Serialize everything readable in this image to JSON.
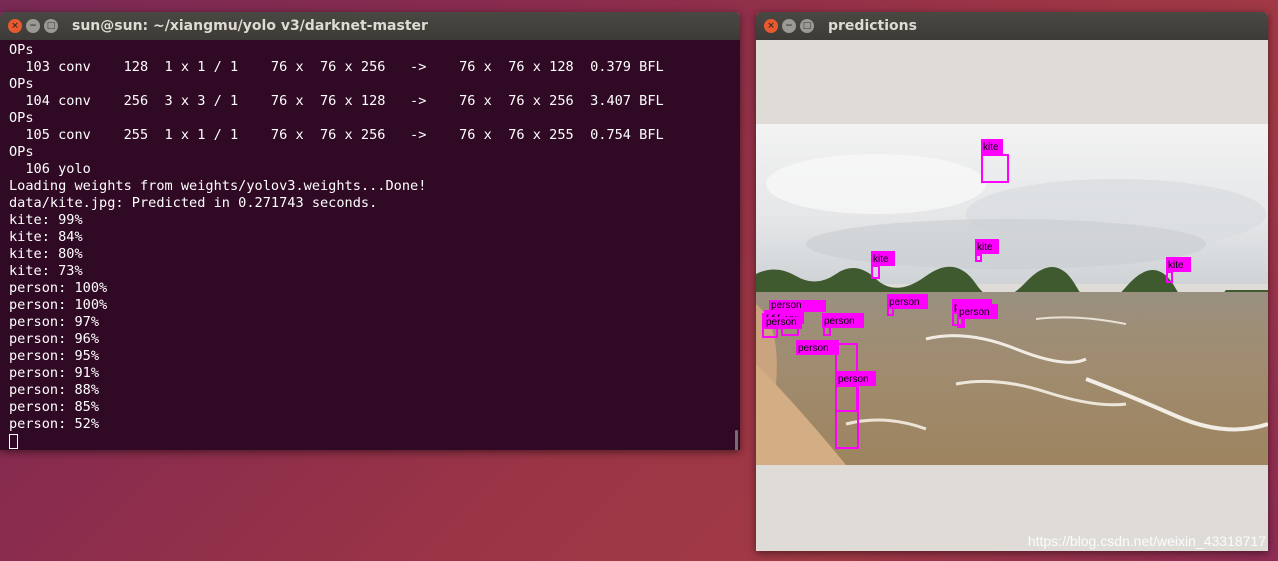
{
  "terminal": {
    "title": "sun@sun: ~/xiangmu/yolo v3/darknet-master",
    "lines": [
      "OPs",
      "  103 conv    128  1 x 1 / 1    76 x  76 x 256   ->    76 x  76 x 128  0.379 BFL",
      "OPs",
      "  104 conv    256  3 x 3 / 1    76 x  76 x 128   ->    76 x  76 x 256  3.407 BFL",
      "OPs",
      "  105 conv    255  1 x 1 / 1    76 x  76 x 256   ->    76 x  76 x 255  0.754 BFL",
      "OPs",
      "  106 yolo",
      "Loading weights from weights/yolov3.weights...Done!",
      "data/kite.jpg: Predicted in 0.271743 seconds.",
      "kite: 99%",
      "kite: 84%",
      "kite: 80%",
      "kite: 73%",
      "person: 100%",
      "person: 100%",
      "person: 97%",
      "person: 96%",
      "person: 95%",
      "person: 91%",
      "person: 88%",
      "person: 85%",
      "person: 52%"
    ]
  },
  "predictions": {
    "title": "predictions",
    "detections": [
      {
        "label": "kite"
      },
      {
        "label": "kite"
      },
      {
        "label": "kite"
      },
      {
        "label": "kite"
      },
      {
        "label": "person"
      },
      {
        "label": "person"
      },
      {
        "label": "person"
      },
      {
        "label": "person"
      },
      {
        "label": "person"
      },
      {
        "label": "person"
      },
      {
        "label": "person"
      },
      {
        "label": "person"
      },
      {
        "label": "person"
      }
    ],
    "watermark": "https://blog.csdn.net/weixin_43318717"
  },
  "window_buttons": {
    "close_icon": "×",
    "minimize_icon": "−",
    "maximize_icon": "□"
  },
  "colors": {
    "terminal_bg": "#300a24",
    "box": "#ff00ff",
    "titlebar": "#3c3b37"
  }
}
